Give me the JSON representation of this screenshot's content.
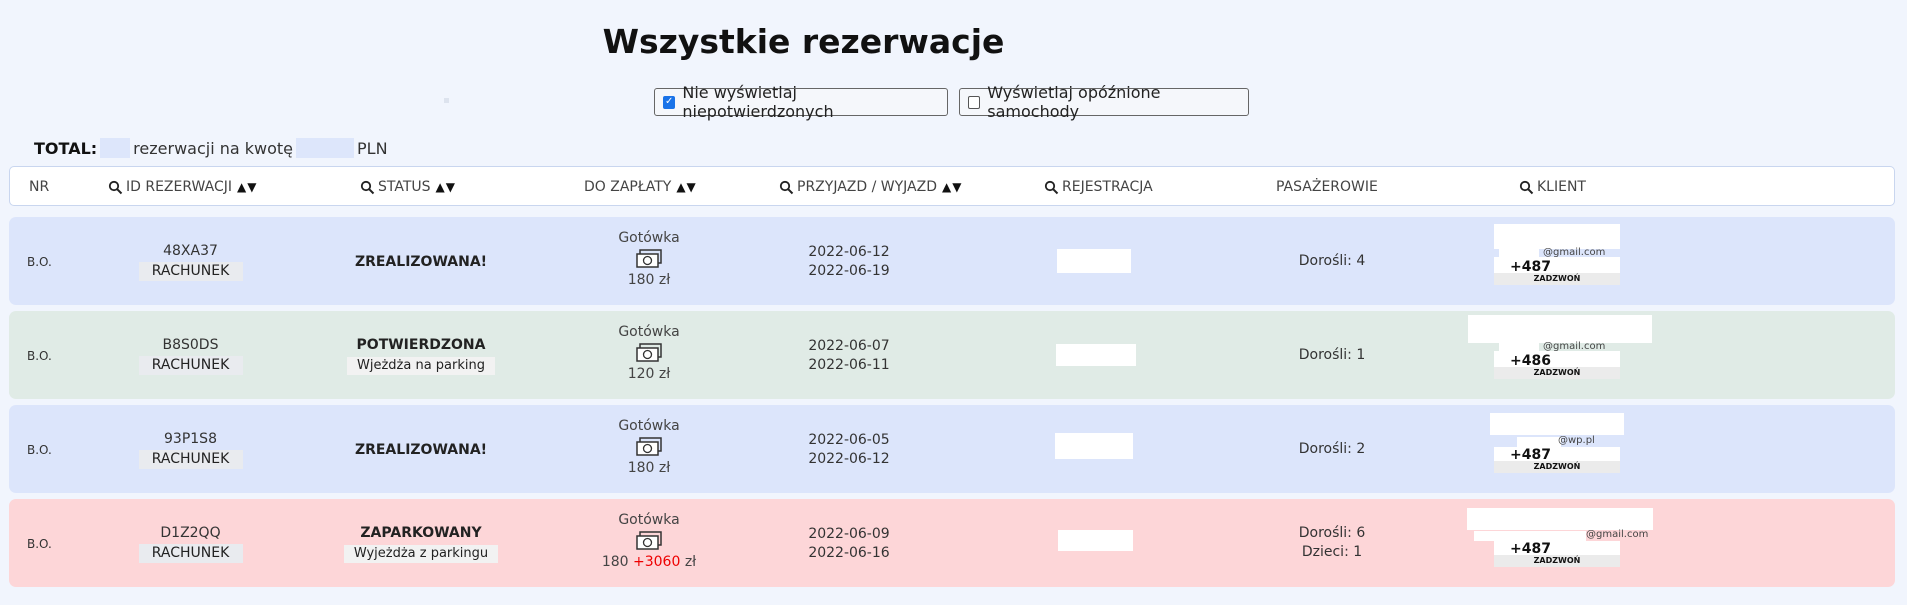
{
  "page_title": "Wszystkie rezerwacje",
  "filters": [
    {
      "label": "Nie wyświetlaj niepotwierdzonych",
      "checked": true
    },
    {
      "label": "Wyświetlaj opóźnione samochody",
      "checked": false
    }
  ],
  "total": {
    "label": "TOTAL:",
    "text_middle": "rezerwacji na kwotę",
    "currency": "PLN"
  },
  "columns": {
    "nr": "NR",
    "id": "ID REZERWACJI",
    "status": "STATUS",
    "payment": "DO ZAPŁATY",
    "dates": "PRZYJAZD / WYJAZD",
    "registration": "REJESTRACJA",
    "passengers": "PASAŻEROWIE",
    "client": "KLIENT",
    "sort_arrows": "▲▼"
  },
  "rows": [
    {
      "nr": "B.O.",
      "code": "48XA37",
      "invoice": "RACHUNEK",
      "status": "ZREALIZOWANA!",
      "status_note": "",
      "payment_method": "Gotówka",
      "amount": "180",
      "extra": "",
      "unit": "zł",
      "arrival": "2022-06-12",
      "departure": "2022-06-19",
      "passengers": [
        "Dorośli: 4"
      ],
      "email_domain": "@gmail.com",
      "phone": "+487",
      "call_label": "ZADZWOŃ"
    },
    {
      "nr": "B.O.",
      "code": "B8S0DS",
      "invoice": "RACHUNEK",
      "status": "POTWIERDZONA",
      "status_note": "Wjeżdża na parking",
      "payment_method": "Gotówka",
      "amount": "120",
      "extra": "",
      "unit": "zł",
      "arrival": "2022-06-07",
      "departure": "2022-06-11",
      "passengers": [
        "Dorośli: 1"
      ],
      "email_domain": "@gmail.com",
      "phone": "+486",
      "call_label": "ZADZWOŃ"
    },
    {
      "nr": "B.O.",
      "code": "93P1S8",
      "invoice": "RACHUNEK",
      "status": "ZREALIZOWANA!",
      "status_note": "",
      "payment_method": "Gotówka",
      "amount": "180",
      "extra": "",
      "unit": "zł",
      "arrival": "2022-06-05",
      "departure": "2022-06-12",
      "passengers": [
        "Dorośli: 2"
      ],
      "email_domain": "@wp.pl",
      "phone": "+487",
      "call_label": "ZADZWOŃ"
    },
    {
      "nr": "B.O.",
      "code": "D1Z2QQ",
      "invoice": "RACHUNEK",
      "status": "ZAPARKOWANY",
      "status_note": "Wyjeżdża z parkingu",
      "payment_method": "Gotówka",
      "amount": "180",
      "extra": "+3060",
      "unit": "zł",
      "arrival": "2022-06-09",
      "departure": "2022-06-16",
      "passengers": [
        "Dorośli: 6",
        "Dzieci: 1"
      ],
      "email_domain": "@gmail.com",
      "phone": "+487",
      "call_label": "ZADZWOŃ"
    }
  ],
  "colors": {
    "row_blue": "#dce5fb",
    "row_green": "#e0ebe6",
    "row_red": "#fdd6d8",
    "extra_amount": "#e00000",
    "checkbox_checked": "#1a73e8"
  },
  "icons": [
    "search-icon",
    "money-icon",
    "checkbox-icon"
  ]
}
